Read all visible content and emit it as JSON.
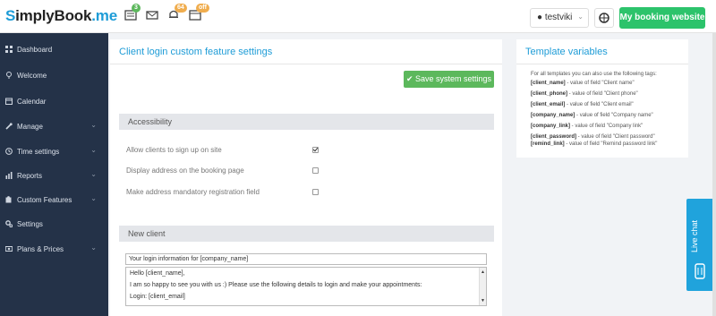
{
  "brand": {
    "logo_main": "implyBook",
    "logo_s": "S",
    "logo_tld": ".me"
  },
  "topbar": {
    "badges": {
      "tasks": "3",
      "notifications": "64",
      "calendar": "off"
    },
    "user_name": "testviki",
    "my_booking_label": "My booking website"
  },
  "sidebar": {
    "items": [
      {
        "label": "Dashboard",
        "icon": "dashboard-icon"
      },
      {
        "label": "Welcome",
        "icon": "lightbulb-icon"
      },
      {
        "label": "Calendar",
        "icon": "calendar-icon"
      },
      {
        "label": "Manage",
        "icon": "wrench-icon"
      },
      {
        "label": "Time settings",
        "icon": "clock-icon"
      },
      {
        "label": "Reports",
        "icon": "bar-chart-icon"
      },
      {
        "label": "Custom Features",
        "icon": "puzzle-icon"
      },
      {
        "label": "Settings",
        "icon": "gears-icon"
      },
      {
        "label": "Plans & Prices",
        "icon": "money-icon"
      }
    ]
  },
  "main": {
    "title": "Client login custom feature settings",
    "save_label": "Save system settings",
    "accessibility_header": "Accessibility",
    "options": [
      {
        "label": "Allow clients to sign up on site",
        "checked": true
      },
      {
        "label": "Display address on the booking page",
        "checked": false
      },
      {
        "label": "Make address mandatory registration field",
        "checked": false
      }
    ],
    "new_client_header": "New client",
    "email_subject": "Your login information for [company_name]",
    "email_body": [
      "Hello [client_name],",
      "I am so happy to see you with us :) Please use the following details to login and make your appointments:",
      "Login: [client_email]"
    ]
  },
  "template_vars": {
    "title": "Template variables",
    "intro": "For all templates you can also use the following tags:",
    "rows": [
      {
        "tag": "[client_name]",
        "desc": " - value of field \"Client name\""
      },
      {
        "tag": "[client_phone]",
        "desc": " - value of field \"Client phone\""
      },
      {
        "tag": "[client_email]",
        "desc": " - value of field \"Client email\""
      },
      {
        "tag": "[company_name]",
        "desc": " - value of field \"Company name\""
      },
      {
        "tag": "[company_link]",
        "desc": " - value of field \"Company link\""
      },
      {
        "tag": "[client_password]",
        "desc": " - value of field \"Client password\""
      },
      {
        "tag": "[remind_link]",
        "desc": " - value of field \"Remind password link\""
      }
    ]
  },
  "livechat": {
    "label": "Live chat"
  },
  "colors": {
    "accent": "#1e9cd7",
    "sidebar": "#243248",
    "success": "#5cb85c",
    "booking": "#2cc36b",
    "livechat": "#20a3dc"
  }
}
